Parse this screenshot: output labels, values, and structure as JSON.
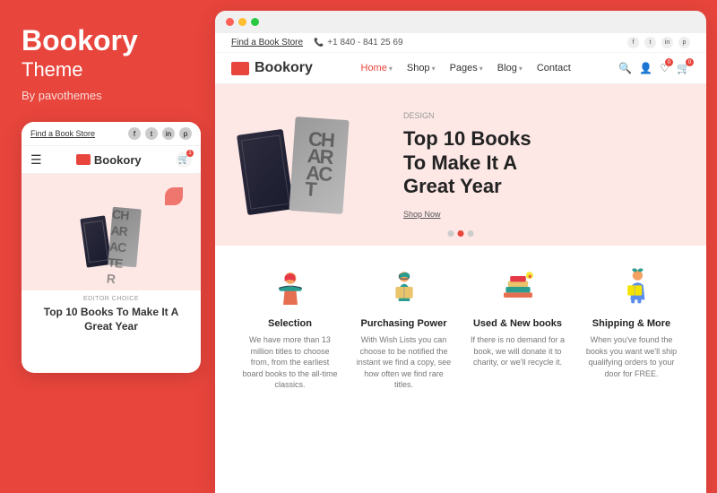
{
  "left": {
    "title": "Bookory",
    "subtitle": "Theme",
    "by": "By pavothemes"
  },
  "mobile": {
    "find_store": "Find a Book Store",
    "brand": "Bookory",
    "cart_badge": "1",
    "editor_choice": "EDITOR CHOICE",
    "hero_title": "Top 10 Books To Make It A Great Year"
  },
  "browser": {
    "dots": [
      "red",
      "yellow",
      "green"
    ]
  },
  "site": {
    "top_bar": {
      "find_store": "Find a Book Store",
      "phone": "+1 840 - 841 25 69"
    },
    "brand": "Bookory",
    "nav": {
      "items": [
        {
          "label": "Home",
          "has_arrow": true,
          "active": true
        },
        {
          "label": "Shop",
          "has_arrow": true,
          "active": false
        },
        {
          "label": "Pages",
          "has_arrow": true,
          "active": false
        },
        {
          "label": "Blog",
          "has_arrow": true,
          "active": false
        },
        {
          "label": "Contact",
          "has_arrow": false,
          "active": false
        }
      ]
    },
    "hero": {
      "tag": "DESIGN",
      "title": "Top 10 Books\nTo Make It A\nGreat Year",
      "shop_now": "Shop Now",
      "char_letters": [
        "C",
        "H",
        "A",
        "R",
        "A",
        "C",
        "T",
        "E",
        "R"
      ]
    },
    "features": [
      {
        "id": "selection",
        "title": "Selection",
        "desc": "We have more than 13 million titles to choose from, from the earliest board books to the all-time classics."
      },
      {
        "id": "purchasing-power",
        "title": "Purchasing Power",
        "desc": "With Wish Lists you can choose to be notified the instant we find a copy, see how often we find rare titles."
      },
      {
        "id": "used-new-books",
        "title": "Used & New books",
        "desc": "If there is no demand for a book, we will donate it to charity, or we'll recycle it."
      },
      {
        "id": "shipping",
        "title": "Shipping & More",
        "desc": "When you've found the books you want we'll ship qualifying orders to your door for FREE."
      }
    ]
  },
  "colors": {
    "accent": "#e8453c",
    "text_dark": "#222222",
    "text_mid": "#555555",
    "text_light": "#777777",
    "hero_bg": "#fde8e6"
  }
}
